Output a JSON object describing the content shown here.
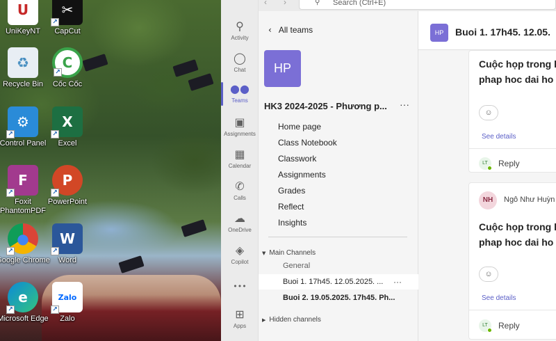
{
  "desktop": {
    "icons": [
      {
        "label": "UniKeyNT",
        "glyph": "U",
        "color": "#c62828"
      },
      {
        "label": "CapCut",
        "glyph": "✂",
        "color": "#111111"
      },
      {
        "label": "Recycle Bin",
        "glyph": "♻",
        "color": "#4a90c2"
      },
      {
        "label": "Cốc Cốc",
        "glyph": "C",
        "color": "#3aa34a"
      },
      {
        "label": "Control Panel",
        "glyph": "⚙",
        "color": "#2a8bd8"
      },
      {
        "label": "Excel",
        "glyph": "X",
        "color": "#1d6f42"
      },
      {
        "label": "Foxit PhantomPDF",
        "glyph": "F",
        "color": "#a23a8e"
      },
      {
        "label": "PowerPoint",
        "glyph": "P",
        "color": "#d24726"
      },
      {
        "label": "Google Chrome",
        "glyph": "●",
        "color": "#4285f4"
      },
      {
        "label": "Word",
        "glyph": "W",
        "color": "#2b579a"
      },
      {
        "label": "Microsoft Edge",
        "glyph": "e",
        "color": "#0c8ad6"
      },
      {
        "label": "Zalo",
        "glyph": "Zalo",
        "color": "#0068ff"
      }
    ]
  },
  "topbar": {
    "search_placeholder": "Search (Ctrl+E)"
  },
  "rail": {
    "items": [
      {
        "label": "Activity",
        "icon": "bell-icon",
        "glyph": "🔔"
      },
      {
        "label": "Chat",
        "icon": "chat-icon",
        "glyph": "💬"
      },
      {
        "label": "Teams",
        "icon": "teams-icon",
        "glyph": "👥"
      },
      {
        "label": "Assignments",
        "icon": "assignments-icon",
        "glyph": "🎒"
      },
      {
        "label": "Calendar",
        "icon": "calendar-icon",
        "glyph": "📅"
      },
      {
        "label": "Calls",
        "icon": "phone-icon",
        "glyph": "✆"
      },
      {
        "label": "OneDrive",
        "icon": "cloud-icon",
        "glyph": "☁"
      },
      {
        "label": "Copilot",
        "icon": "copilot-icon",
        "glyph": "◈"
      },
      {
        "label": "",
        "icon": "more-icon",
        "glyph": "•••"
      },
      {
        "label": "Apps",
        "icon": "apps-icon",
        "glyph": "⊞"
      }
    ]
  },
  "team_panel": {
    "back_label": "All teams",
    "avatar_initials": "HP",
    "team_name": "HK3 2024-2025 - Phương p...",
    "menu": [
      "Home page",
      "Class Notebook",
      "Classwork",
      "Assignments",
      "Grades",
      "Reflect",
      "Insights"
    ],
    "main_channels_label": "Main Channels",
    "channels": [
      "General",
      "Buoi 1. 17h45. 12.05.2025. ...",
      "Buoi 2. 19.05.2025. 17h45. Ph..."
    ],
    "hidden_channels_label": "Hidden channels"
  },
  "channel": {
    "avatar_initials": "HP",
    "title": "Buoi 1. 17h45. 12.05.",
    "posts": [
      {
        "line1": "Cuộc họp trong l",
        "line2": "phap hoc dai ho",
        "see_details": "See details",
        "reply_initials": "LT",
        "reply_label": "Reply"
      },
      {
        "author_initials": "NH",
        "author": "Ngô Như Huỳn",
        "line1": "Cuộc họp trong l",
        "line2": "phap hoc dai ho",
        "see_details": "See details",
        "reply_initials": "LT",
        "reply_label": "Reply"
      }
    ]
  }
}
